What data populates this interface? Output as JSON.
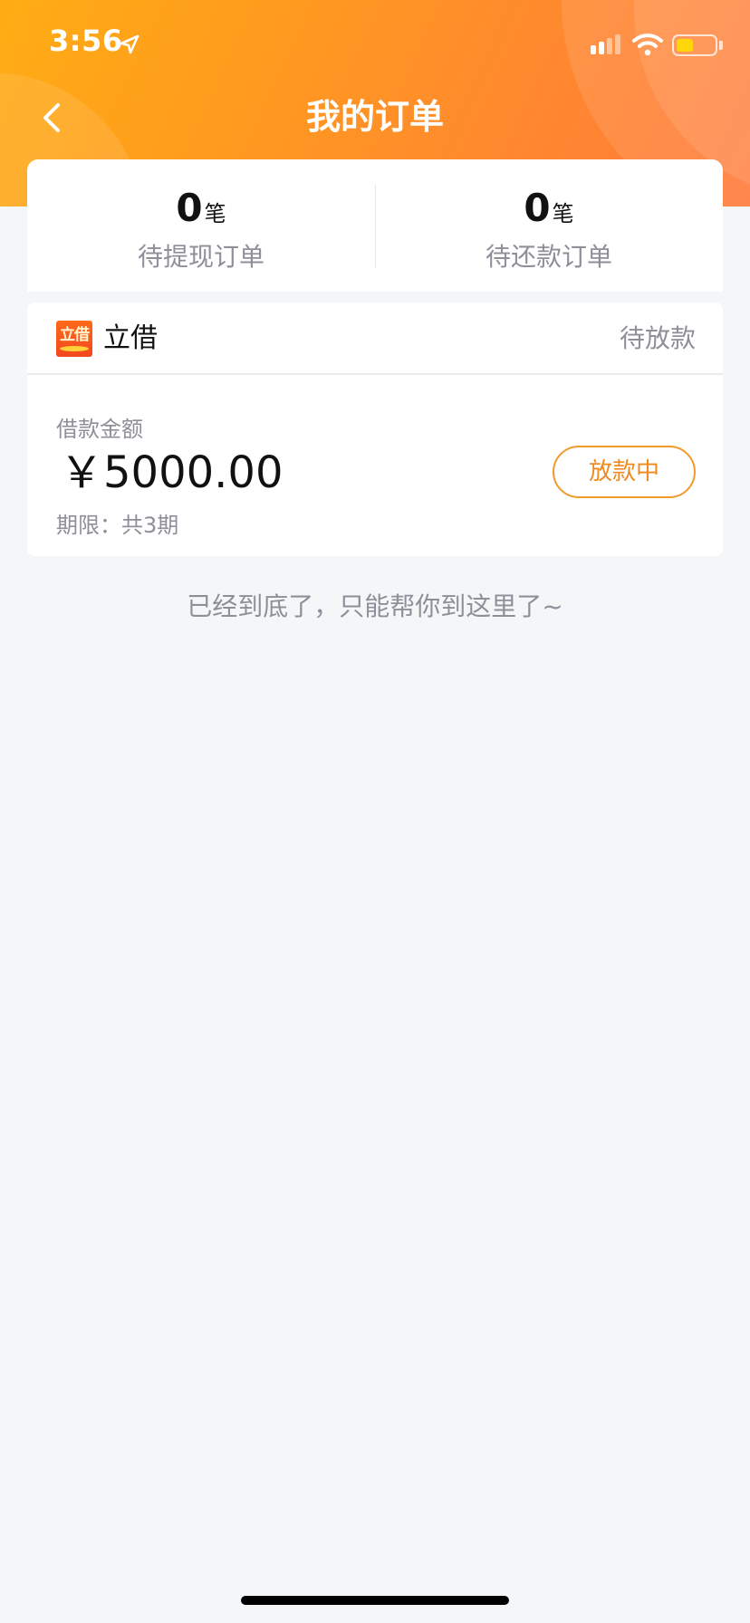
{
  "status_bar": {
    "time": "3:56",
    "location_icon": "location-arrow-icon",
    "signal_icon": "cellular-signal-icon",
    "wifi_icon": "wifi-icon",
    "battery_icon": "battery-icon",
    "battery_level": 0.45,
    "battery_color": "#ffd60a"
  },
  "nav": {
    "back_icon": "chevron-left-icon",
    "title": "我的订单"
  },
  "summary": {
    "pending_withdraw": {
      "count": "0",
      "unit": "笔",
      "label": "待提现订单"
    },
    "pending_repay": {
      "count": "0",
      "unit": "笔",
      "label": "待还款订单"
    }
  },
  "order": {
    "brand": "立借",
    "logo_text": "立借",
    "status": "待放款",
    "amount_label": "借款金额",
    "amount": "￥5000.00",
    "term": "期限：共3期",
    "button_label": "放款中"
  },
  "footer": {
    "end_text": "已经到底了，只能帮你到这里了~"
  },
  "colors": {
    "header_gradient_start": "#ffad14",
    "header_gradient_end": "#ff7a3a",
    "accent": "#f08a1c",
    "background": "#f5f6f8"
  }
}
